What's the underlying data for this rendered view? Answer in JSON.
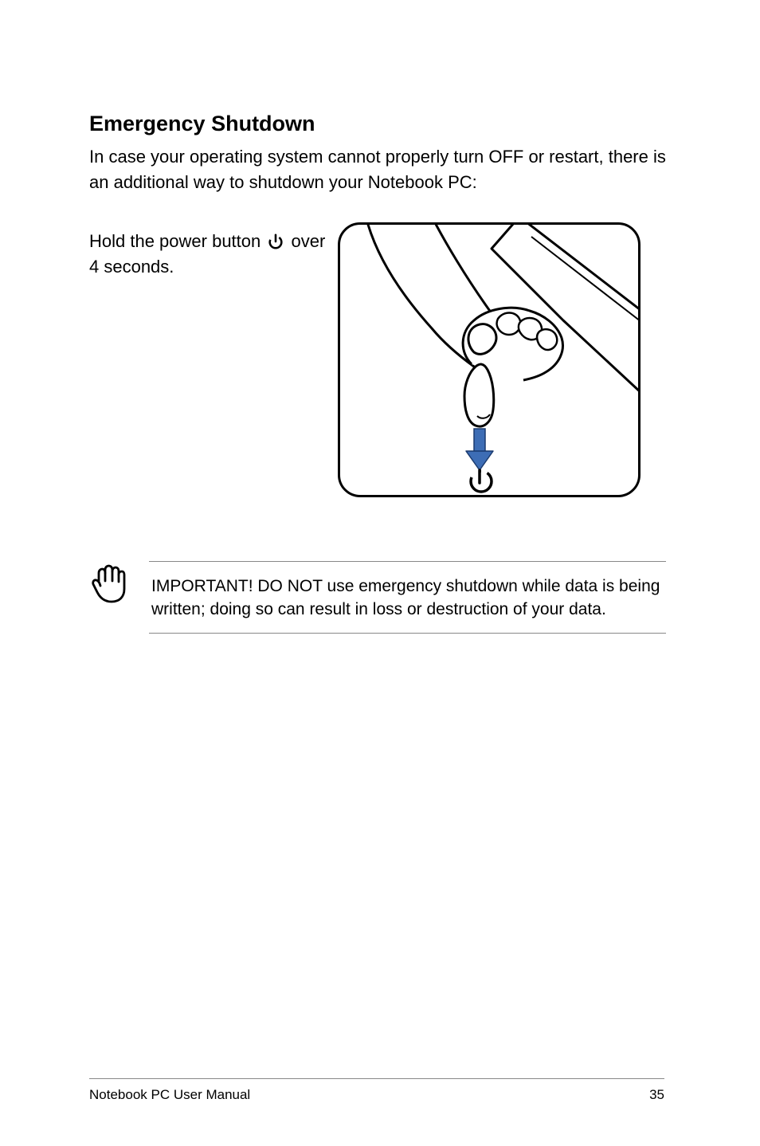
{
  "heading": "Emergency Shutdown",
  "intro": "In case your operating system cannot properly turn OFF or restart, there is an additional way to shutdown your Notebook PC:",
  "instruction_pre": "Hold the power button ",
  "instruction_post": " over 4 seconds.",
  "callout": "IMPORTANT!  DO NOT use emergency shutdown while data is being written; doing so can result in loss or destruction of your data.",
  "footer_left": "Notebook PC User Manual",
  "footer_right": "35"
}
